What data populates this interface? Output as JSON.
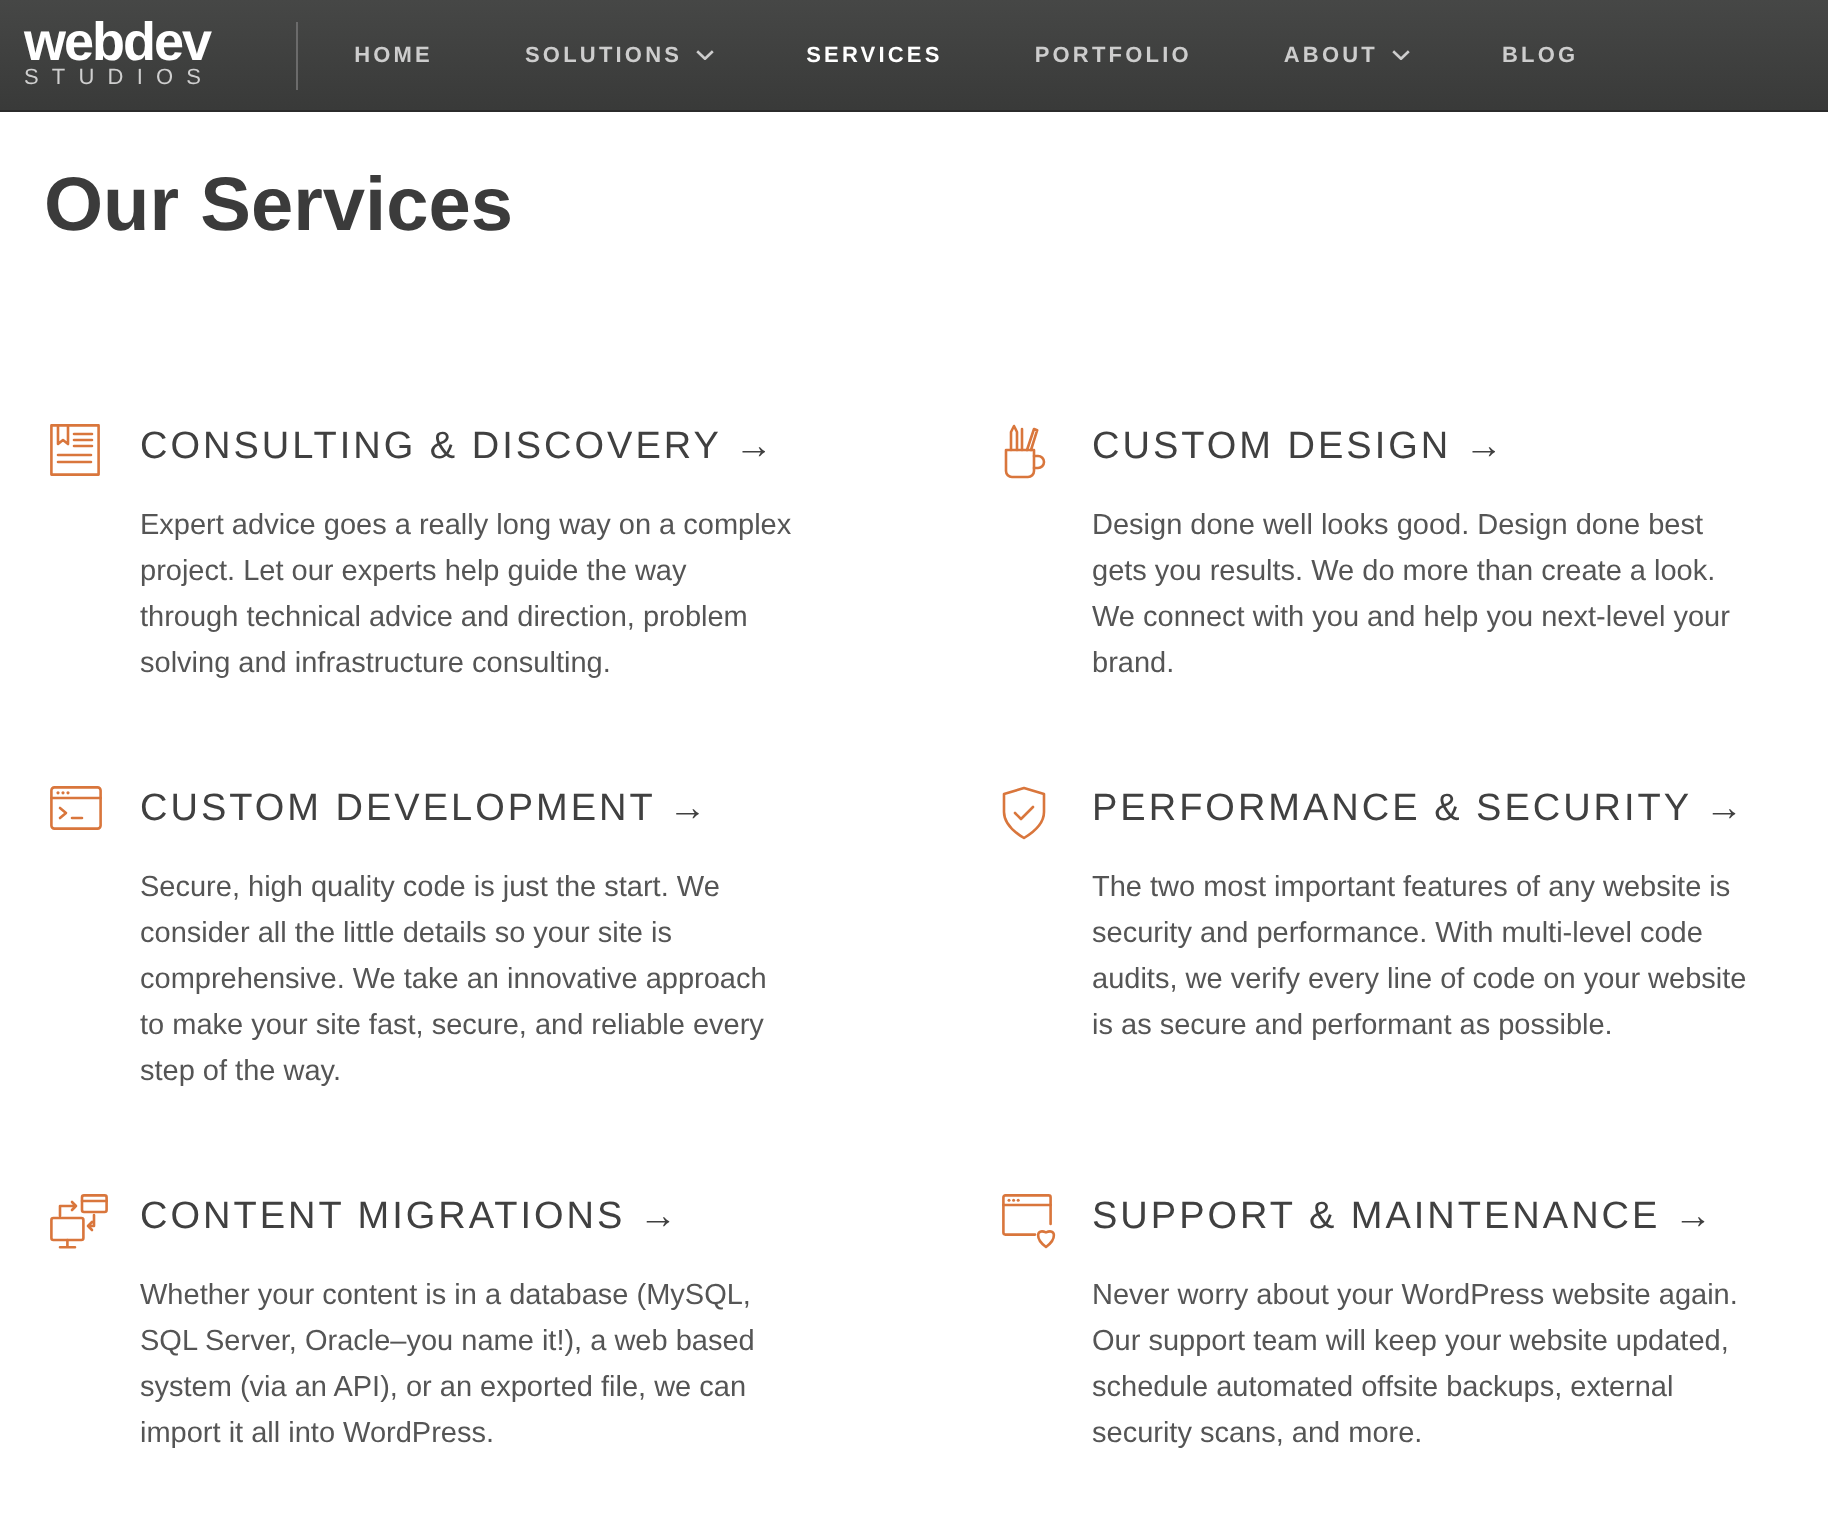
{
  "header": {
    "logo": {
      "wordmark": "webdev",
      "tagline": "STUDIOS"
    },
    "nav": [
      {
        "label": "HOME",
        "selected": false,
        "dropdown": false
      },
      {
        "label": "SOLUTIONS",
        "selected": false,
        "dropdown": true
      },
      {
        "label": "SERVICES",
        "selected": true,
        "dropdown": false
      },
      {
        "label": "PORTFOLIO",
        "selected": false,
        "dropdown": false
      },
      {
        "label": "ABOUT",
        "selected": false,
        "dropdown": true
      },
      {
        "label": "BLOG",
        "selected": false,
        "dropdown": false
      }
    ]
  },
  "page_title": "Our Services",
  "services": [
    {
      "title": "CONSULTING & DISCOVERY →",
      "description": "Expert advice goes a really long way on a complex project. Let our experts help guide the way through technical advice and direction, problem solving and infrastructure consulting."
    },
    {
      "title": "CUSTOM DESIGN →",
      "description": "Design done well looks good. Design done best gets you results. We do more than create a look. We connect with you and help you next-level your brand."
    },
    {
      "title": "CUSTOM DEVELOPMENT →",
      "description": "Secure, high quality code is just the start. We consider all the little details so your site is comprehensive. We take an innovative approach to make your site fast, secure, and reliable every step of the way."
    },
    {
      "title": "PERFORMANCE & SECURITY →",
      "description": "The two most important features of any website is security and performance. With multi-level code audits, we verify every line of code on your website is as secure and performant as possible."
    },
    {
      "title": "CONTENT MIGRATIONS →",
      "description": "Whether your content is in a database (MySQL, SQL Server, Oracle–you name it!), a web based system (via an API), or an exported file, we can import it all into WordPress."
    },
    {
      "title": "SUPPORT & MAINTENANCE →",
      "description": "Never worry about your WordPress website again. Our support team will keep your website updated, schedule automated offsite backups, external security scans, and more."
    }
  ]
}
